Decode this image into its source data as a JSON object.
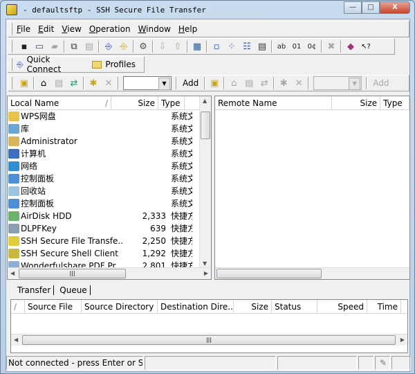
{
  "window": {
    "title": "- defaultsftp - SSH Secure File Transfer",
    "minimize": "—",
    "maximize": "□",
    "close": "X"
  },
  "menu": [
    "File",
    "Edit",
    "View",
    "Operation",
    "Window",
    "Help"
  ],
  "toolbar": [
    "save",
    "new-terminal",
    "new-file-transfer-disabled",
    "|",
    "copy",
    "paste-disabled",
    "|",
    "connect",
    "disconnect",
    "|",
    "settings",
    "|",
    "download-disabled",
    "upload-disabled",
    "|",
    "file-view",
    "|",
    "large-icons",
    "small-icons",
    "list-view",
    "details-view",
    "|",
    "ascii-mode",
    "binary-mode",
    "auto-mode",
    "|",
    "stop-disabled",
    "|",
    "help-book",
    "context-help"
  ],
  "quickbar": {
    "quick_connect": "Quick Connect",
    "profiles": "Profiles"
  },
  "local_toolbar": {
    "add": "Add"
  },
  "remote_toolbar": {
    "add": "Add"
  },
  "local": {
    "columns": [
      "Local Name",
      "/",
      "Size",
      "Type"
    ],
    "rows": [
      {
        "name": "WPS网盘",
        "size": "",
        "type": "系统文",
        "icon": "folder",
        "color": "#e8c34a"
      },
      {
        "name": "库",
        "size": "",
        "type": "系统文",
        "icon": "library",
        "color": "#6aa6d8"
      },
      {
        "name": "Administrator",
        "size": "",
        "type": "系统文",
        "icon": "user-folder",
        "color": "#d9b45a"
      },
      {
        "name": "计算机",
        "size": "",
        "type": "系统文",
        "icon": "computer",
        "color": "#3a6fc4"
      },
      {
        "name": "网络",
        "size": "",
        "type": "系统文",
        "icon": "network",
        "color": "#2f8fd0"
      },
      {
        "name": "控制面板",
        "size": "",
        "type": "系统文",
        "icon": "control-panel",
        "color": "#4d8fd8"
      },
      {
        "name": "回收站",
        "size": "",
        "type": "系统文",
        "icon": "recycle-bin",
        "color": "#9cc3e0"
      },
      {
        "name": "控制面板",
        "size": "",
        "type": "系统文",
        "icon": "control-panel",
        "color": "#4d8fd8"
      },
      {
        "name": "AirDisk HDD",
        "size": "2,333",
        "type": "快捷方",
        "icon": "shortcut",
        "color": "#6bb36b"
      },
      {
        "name": "DLPFKey",
        "size": "639",
        "type": "快捷方",
        "icon": "shortcut",
        "color": "#8aa0b0"
      },
      {
        "name": "SSH Secure File Transfe...",
        "size": "2,250",
        "type": "快捷方",
        "icon": "ssh-transfer",
        "color": "#e2cc3c"
      },
      {
        "name": "SSH Secure Shell Client",
        "size": "1,292",
        "type": "快捷方",
        "icon": "ssh-shell",
        "color": "#c9b83c"
      },
      {
        "name": "Wonderfulshare PDF Pr...",
        "size": "2,801",
        "type": "快捷方",
        "icon": "shortcut",
        "color": "#8ab0d8"
      }
    ]
  },
  "remote": {
    "columns": [
      "Remote Name",
      "Size",
      "Type"
    ]
  },
  "tabs": [
    "Transfer",
    "Queue"
  ],
  "transfer": {
    "columns": [
      "/",
      "Source File",
      "Source Directory",
      "Destination Dire...",
      "Size",
      "Status",
      "Speed",
      "Time"
    ]
  },
  "statusbar": {
    "message": "Not connected - press Enter or S"
  }
}
